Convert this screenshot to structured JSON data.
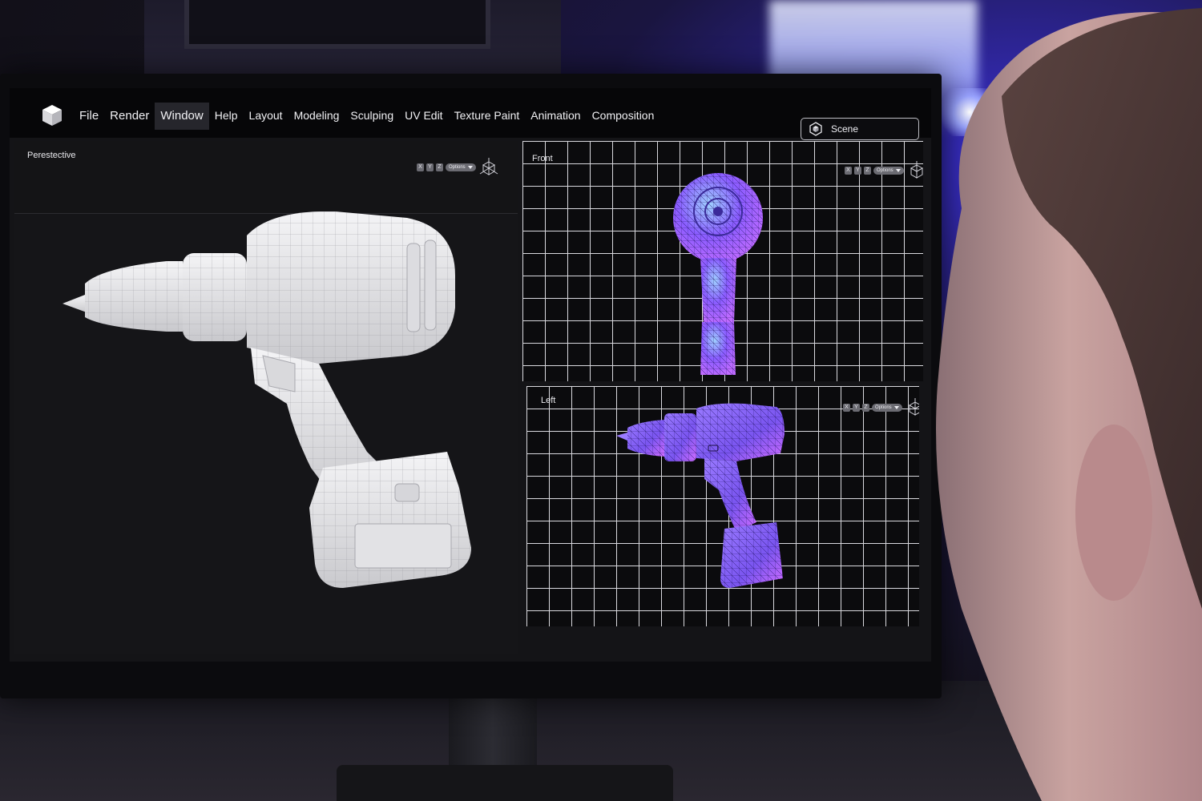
{
  "menu": {
    "items": [
      {
        "label": "File",
        "active": false
      },
      {
        "label": "Render",
        "active": false
      },
      {
        "label": "Window",
        "active": true
      },
      {
        "label": "Help",
        "active": false
      },
      {
        "label": "Layout",
        "active": false
      },
      {
        "label": "Modeling",
        "active": false
      },
      {
        "label": "Sculping",
        "active": false
      },
      {
        "label": "UV Edit",
        "active": false
      },
      {
        "label": "Texture Paint",
        "active": false
      },
      {
        "label": "Animation",
        "active": false
      },
      {
        "label": "Composition",
        "active": false
      }
    ]
  },
  "scene_selector": {
    "label": "Scene"
  },
  "viewports": {
    "perspective": {
      "title": "Perestective",
      "axes": [
        "X",
        "Y",
        "Z"
      ],
      "options_label": "Options"
    },
    "front": {
      "title": "Front",
      "axes": [
        "X",
        "Y",
        "Z"
      ],
      "options_label": "Options"
    },
    "left": {
      "title": "Left",
      "axes": [
        "X",
        "Y",
        "Z"
      ],
      "options_label": "Options"
    }
  },
  "colors": {
    "menubar_bg": "#060608",
    "active_menu_bg": "#26262c",
    "wireframe_accent": "#8a5cff",
    "model_clay": "#e4e4e6"
  },
  "icons": {
    "app_logo": "cube-icon",
    "scene": "scene-cube-icon",
    "gizmo": "axis-gizmo-icon"
  }
}
